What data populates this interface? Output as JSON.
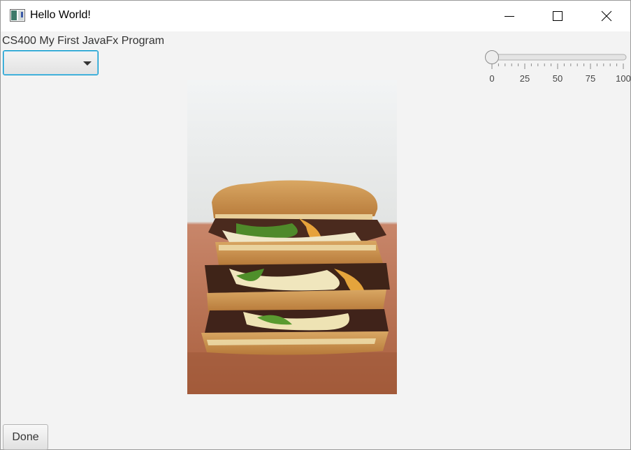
{
  "window": {
    "title": "Hello World!",
    "icon": "javafx-window-icon",
    "controls": [
      "minimize-icon",
      "maximize-icon",
      "close-icon"
    ]
  },
  "main": {
    "heading": "CS400 My First JavaFx Program",
    "combo": {
      "selected": ""
    },
    "slider": {
      "value": 0,
      "min": 0,
      "max": 100,
      "tick_labels": [
        "0",
        "25",
        "50",
        "75",
        "100"
      ]
    },
    "image": {
      "subject": "stacked grilled sandwich"
    },
    "done_label": "Done"
  },
  "colors": {
    "accent": "#0096c9",
    "background": "#f3f3f3"
  }
}
